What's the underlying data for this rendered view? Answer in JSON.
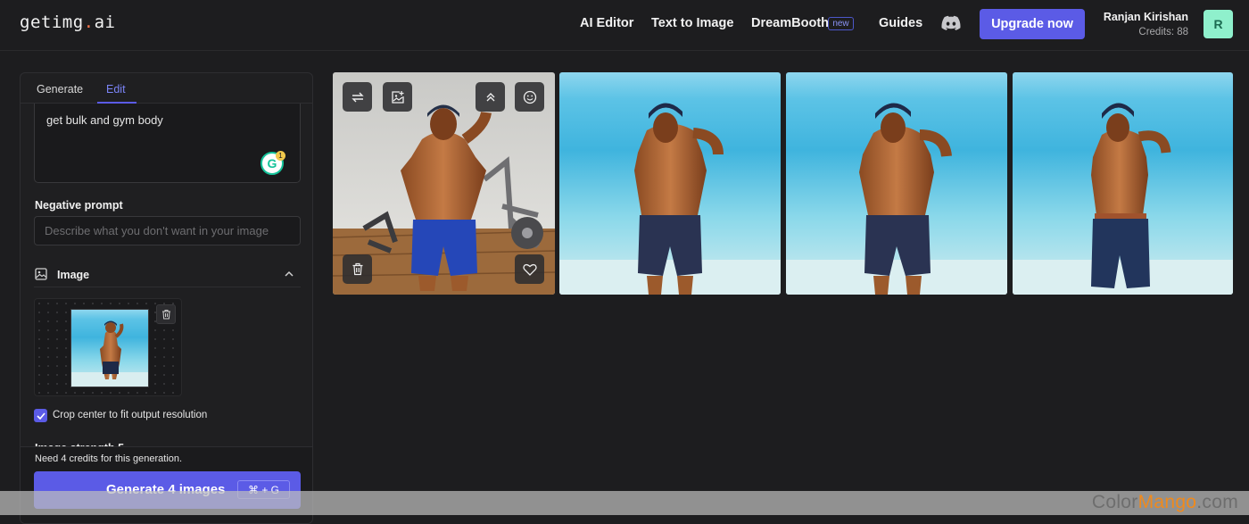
{
  "header": {
    "logo_main": "getimg",
    "logo_dot": ".",
    "logo_tail": "ai",
    "nav": [
      "AI Editor",
      "Text to Image",
      "DreamBooth",
      "Guides"
    ],
    "new_badge": "new",
    "upgrade_label": "Upgrade now",
    "user_name": "Ranjan Kirishan",
    "credits": "Credits: 88",
    "avatar_initial": "R"
  },
  "panel": {
    "tabs": [
      "Generate",
      "Edit"
    ],
    "active_tab": "Edit",
    "prompt_text": "get bulk and gym body",
    "grammarly_letter": "G",
    "grammarly_count": "1",
    "negative_label": "Negative prompt",
    "negative_placeholder": "Describe what you don't want in your image",
    "image_section_label": "Image",
    "crop_label": "Crop center to fit output resolution",
    "crop_checked": true,
    "partial_label": "Image strength 5",
    "need_credits": "Need 4 credits for this generation.",
    "generate_label": "Generate 4 images",
    "shortcut": "⌘ + G"
  },
  "results": {
    "count": 4,
    "overlay_icons": [
      "swap-icon",
      "image-plus-icon",
      "upscale-icon",
      "face-icon",
      "trash-icon",
      "heart-icon"
    ]
  },
  "watermark": {
    "part1": "Color",
    "part2": "Mango",
    "part3": ".com"
  },
  "colors": {
    "accent": "#5b5be6",
    "background": "#1d1d1f",
    "panel": "#1f1f21"
  }
}
